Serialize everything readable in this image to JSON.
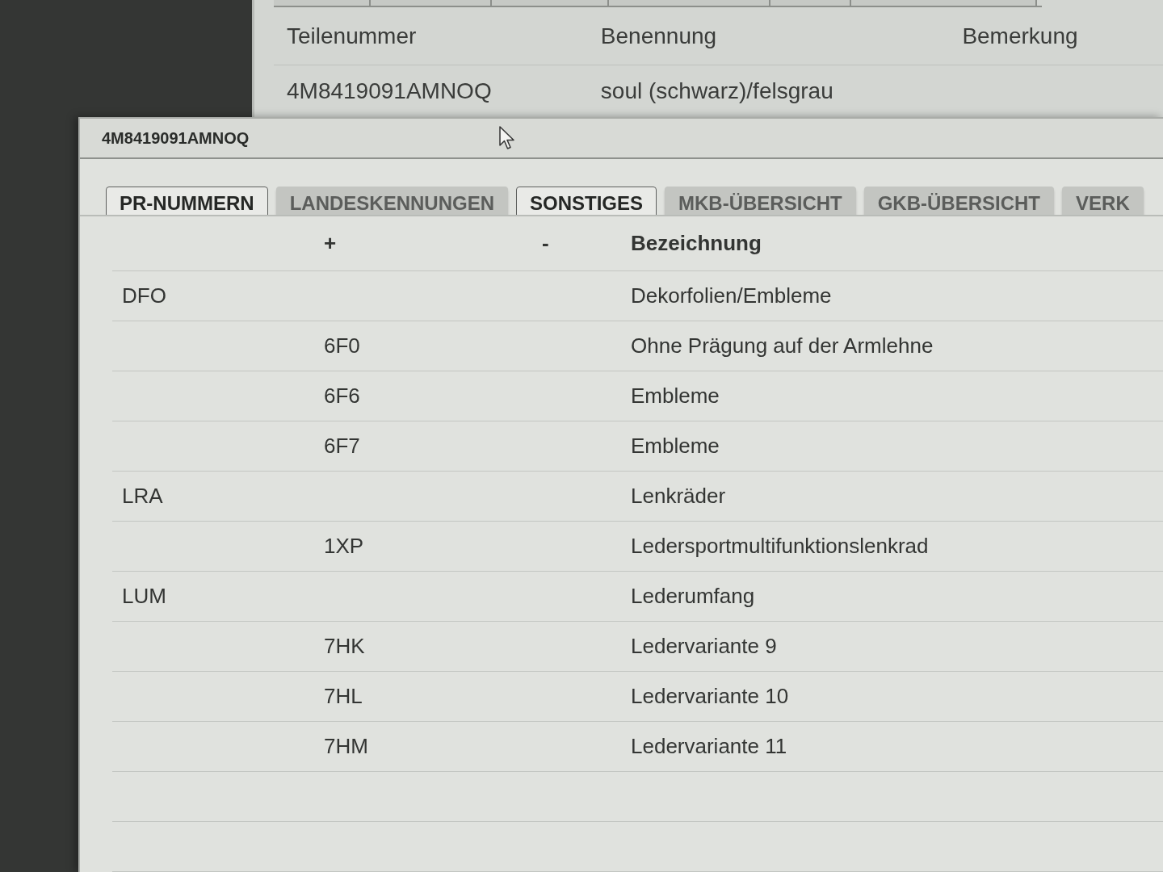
{
  "background_window": {
    "table": {
      "columns": [
        "Teilenummer",
        "Benennung",
        "Bemerkung"
      ],
      "rows": [
        {
          "cells": [
            "4M8419091AMNOQ",
            "soul (schwarz)/felsgrau"
          ]
        }
      ]
    }
  },
  "dialog": {
    "title": "4M8419091AMNOQ",
    "tabs": [
      {
        "label": "PR-NUMMERN",
        "selected": true
      },
      {
        "label": "LANDESKENNUNGEN",
        "selected": false
      },
      {
        "label": "SONSTIGES",
        "selected": true
      },
      {
        "label": "MKB-ÜBERSICHT",
        "selected": false
      },
      {
        "label": "GKB-ÜBERSICHT",
        "selected": false
      },
      {
        "label": "VERK",
        "selected": false
      }
    ],
    "table": {
      "columns": [
        "+",
        "-",
        "Bezeichnung"
      ],
      "rows": [
        {
          "kind": "group",
          "code": "DFO",
          "text": "Dekorfolien/Embleme"
        },
        {
          "kind": "option",
          "code": "6F0",
          "text": "Ohne Prägung auf der Armlehne"
        },
        {
          "kind": "option",
          "code": "6F6",
          "text": "Embleme"
        },
        {
          "kind": "option",
          "code": "6F7",
          "text": "Embleme"
        },
        {
          "kind": "group",
          "code": "LRA",
          "text": "Lenkräder"
        },
        {
          "kind": "option",
          "code": "1XP",
          "text": "Ledersportmultifunktionslenkrad"
        },
        {
          "kind": "group",
          "code": "LUM",
          "text": "Lederumfang"
        },
        {
          "kind": "option",
          "code": "7HK",
          "text": "Ledervariante 9"
        },
        {
          "kind": "option",
          "code": "7HL",
          "text": "Ledervariante 10"
        },
        {
          "kind": "option",
          "code": "7HM",
          "text": "Ledervariante 11"
        }
      ]
    }
  }
}
